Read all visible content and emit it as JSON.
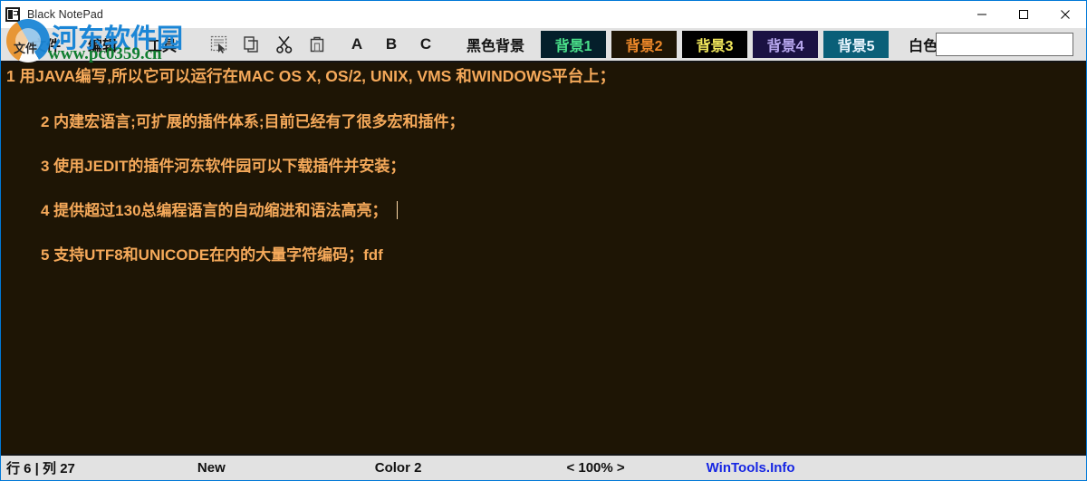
{
  "window": {
    "title": "Black NotePad",
    "icon": "notepad-icon",
    "controls": {
      "minimize": "—",
      "maximize": "□",
      "close": "✕"
    }
  },
  "menu": {
    "items": [
      {
        "label": "文件",
        "name": "menu-file"
      },
      {
        "label": "编辑",
        "name": "menu-edit"
      },
      {
        "label": "工具",
        "name": "menu-tools"
      }
    ]
  },
  "toolbar": {
    "icons": [
      {
        "name": "select-all-icon",
        "title": "Select All"
      },
      {
        "name": "copy-icon",
        "title": "Copy"
      },
      {
        "name": "cut-icon",
        "title": "Cut"
      },
      {
        "name": "paste-icon",
        "title": "Paste"
      }
    ],
    "letters": [
      {
        "label": "A",
        "name": "font-size-a-button"
      },
      {
        "label": "B",
        "name": "font-size-b-button"
      },
      {
        "label": "C",
        "name": "font-size-c-button"
      }
    ],
    "theme_buttons": [
      {
        "label": "黑色背景",
        "name": "theme-black-button",
        "bg": "transparent",
        "fg": "#111111"
      },
      {
        "label": "背景1",
        "name": "theme-bg1-button",
        "bg": "#041f2b",
        "fg": "#4ae08a"
      },
      {
        "label": "背景2",
        "name": "theme-bg2-button",
        "bg": "#1e1505",
        "fg": "#f08a2a"
      },
      {
        "label": "背景3",
        "name": "theme-bg3-button",
        "bg": "#000000",
        "fg": "#f2e85c"
      },
      {
        "label": "背景4",
        "name": "theme-bg4-button",
        "bg": "#1b1243",
        "fg": "#b8a8ef"
      },
      {
        "label": "背景5",
        "name": "theme-bg5-button",
        "bg": "#0a5f78",
        "fg": "#eaf6ff"
      },
      {
        "label": "白色背景",
        "name": "theme-white-button",
        "bg": "transparent",
        "fg": "#111111"
      }
    ],
    "search_field_value": ""
  },
  "editor": {
    "background": "#1e1505",
    "foreground": "#f5a95a",
    "lines": [
      "1 用JAVA编写,所以它可以运行在MAC OS X, OS/2, UNIX, VMS 和WINDOWS平台上；",
      "2 内建宏语言;可扩展的插件体系;目前已经有了很多宏和插件；",
      "3 使用JEDIT的插件河东软件园可以下载插件并安装；",
      "4 提供超过130总编程语言的自动缩进和语法高亮；",
      "5 支持UTF8和UNICODE在内的大量字符编码；fdf"
    ]
  },
  "statusbar": {
    "position": "行 6 | 列 27",
    "filename": "New",
    "color": "Color 2",
    "zoom": "< 100% >",
    "brand": "WinTools.Info",
    "brand_color": "#1626e3"
  },
  "watermark": {
    "text": "河东软件园",
    "url": "www.pc0359.cn",
    "logo_label": "文件"
  }
}
